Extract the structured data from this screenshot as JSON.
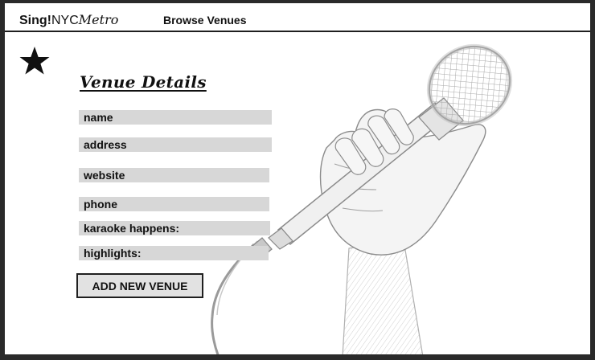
{
  "header": {
    "brand_part1": "Sing!",
    "brand_part2": "NYC",
    "brand_part3": "Metro",
    "nav_browse_label": "Browse Venues"
  },
  "icons": {
    "favorite": "star-icon",
    "illustration": "microphone-hand-illustration"
  },
  "form": {
    "title": "Venue Details",
    "fields": {
      "name": {
        "placeholder": "name",
        "value": ""
      },
      "address": {
        "placeholder": "address",
        "value": ""
      },
      "website": {
        "placeholder": "website",
        "value": ""
      },
      "phone": {
        "placeholder": "phone",
        "value": ""
      },
      "karaoke": {
        "placeholder": "karaoke happens:",
        "value": ""
      },
      "highlights": {
        "placeholder": "highlights:",
        "value": ""
      }
    },
    "submit_label": "ADD NEW VENUE"
  },
  "colors": {
    "field_fill": "#d7d7d7",
    "button_fill": "#e2e2e2",
    "ink": "#111111",
    "frame_bg": "#ffffff",
    "outer_bg": "#2a2a2a"
  }
}
